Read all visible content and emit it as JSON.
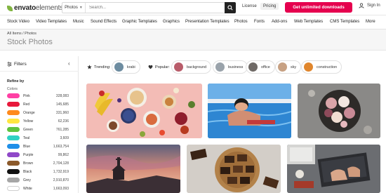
{
  "header": {
    "logo_bold": "envato",
    "logo_light": "elements",
    "search_category": "Photos",
    "search_placeholder": "Search...",
    "license_label": "License",
    "pricing_label": "Pricing",
    "cta_label": "Get unlimited downloads",
    "signin_label": "Sign In"
  },
  "categories": [
    "Stock Video",
    "Video Templates",
    "Music",
    "Sound Effects",
    "Graphic Templates",
    "Graphics",
    "Presentation Templates",
    "Photos",
    "Fonts",
    "Add-ons",
    "Web Templates",
    "CMS Templates",
    "More"
  ],
  "page": {
    "breadcrumb": "All Items / Photos",
    "title": "Stock Photos"
  },
  "sidebar": {
    "filters_label": "Filters",
    "refine_label": "Refine by",
    "colors_label": "Colors",
    "colors": [
      {
        "name": "Pink",
        "count": "328,083",
        "hex": "#ff3fa4"
      },
      {
        "name": "Red",
        "count": "145,685",
        "hex": "#e8193c"
      },
      {
        "name": "Orange",
        "count": "331,960",
        "hex": "#ff8a1c"
      },
      {
        "name": "Yellow",
        "count": "62,236",
        "hex": "#ffe640"
      },
      {
        "name": "Green",
        "count": "761,285",
        "hex": "#5fc33f"
      },
      {
        "name": "Teal",
        "count": "3,609",
        "hex": "#2fd1c4"
      },
      {
        "name": "Blue",
        "count": "1,663,754",
        "hex": "#1f8fe8"
      },
      {
        "name": "Purple",
        "count": "99,862",
        "hex": "#8f48c8"
      },
      {
        "name": "Brown",
        "count": "2,704,128",
        "hex": "#8c5a2b"
      },
      {
        "name": "Black",
        "count": "1,732,919",
        "hex": "#111111"
      },
      {
        "name": "Grey",
        "count": "2,910,870",
        "hex": "#a6a6a6"
      },
      {
        "name": "White",
        "count": "1,663,093",
        "hex": "#ffffff"
      }
    ]
  },
  "chips": {
    "trending_label": "Trending:",
    "popular_label": "Popular:",
    "trending": [
      {
        "label": "krabi",
        "hex": "#6d8ca0"
      }
    ],
    "popular": [
      {
        "label": "background",
        "hex": "#b85c6a"
      },
      {
        "label": "business",
        "hex": "#9aa3ab"
      },
      {
        "label": "office",
        "hex": "#6f6a66"
      },
      {
        "label": "sky",
        "hex": "#c7a183"
      },
      {
        "label": "construction",
        "hex": "#e0862d"
      }
    ]
  },
  "colors": {
    "brand_green": "#82b541",
    "cta_pink": "#e5004e"
  }
}
